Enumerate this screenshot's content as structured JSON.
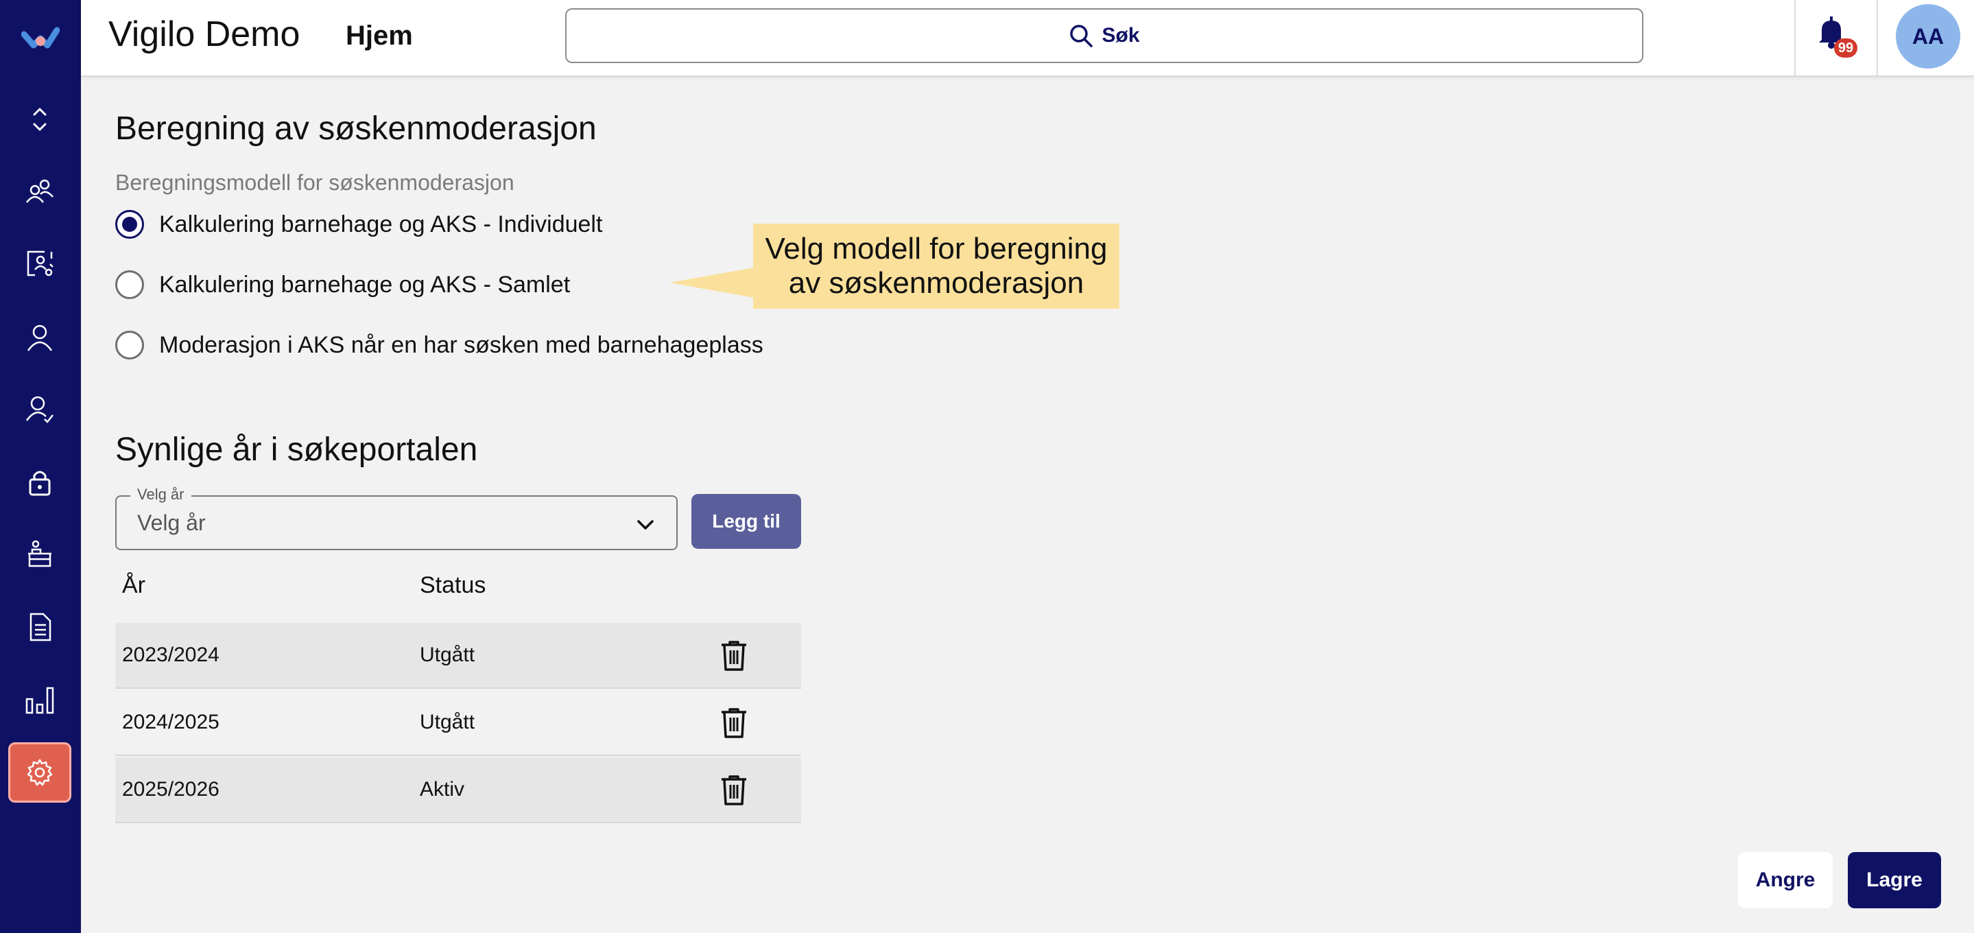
{
  "header": {
    "app_title": "Vigilo Demo",
    "nav_home": "Hjem",
    "search_label": "Søk",
    "notification_count": "99",
    "avatar_initials": "AA"
  },
  "sidebar": {
    "items": [
      {
        "icon": "expand-collapse-icon"
      },
      {
        "icon": "users-group-icon"
      },
      {
        "icon": "org-chart-icon"
      },
      {
        "icon": "person-icon"
      },
      {
        "icon": "person-check-icon"
      },
      {
        "icon": "lock-icon"
      },
      {
        "icon": "kindergarten-icon"
      },
      {
        "icon": "document-icon"
      },
      {
        "icon": "bar-chart-icon"
      },
      {
        "icon": "gear-icon",
        "active": true
      }
    ],
    "active_color": "#e0604f",
    "background_color": "#0f1264"
  },
  "sibling_section": {
    "title": "Beregning av søskenmoderasjon",
    "subtitle": "Beregningsmodell for søskenmoderasjon",
    "options": [
      {
        "label": "Kalkulering barnehage og AKS - Individuelt",
        "selected": true
      },
      {
        "label": "Kalkulering barnehage og AKS - Samlet",
        "selected": false
      },
      {
        "label": "Moderasjon i AKS når en har søsken med barnehageplass",
        "selected": false
      }
    ],
    "callout": "Velg modell for beregning av søskenmoderasjon"
  },
  "years_section": {
    "title": "Synlige år i søkeportalen",
    "select_legend": "Velg år",
    "select_placeholder": "Velg år",
    "add_button": "Legg til",
    "columns": [
      "År",
      "Status"
    ],
    "rows": [
      {
        "year": "2023/2024",
        "status": "Utgått"
      },
      {
        "year": "2024/2025",
        "status": "Utgått"
      },
      {
        "year": "2025/2026",
        "status": "Aktiv"
      }
    ]
  },
  "footer": {
    "cancel_label": "Angre",
    "save_label": "Lagre"
  }
}
